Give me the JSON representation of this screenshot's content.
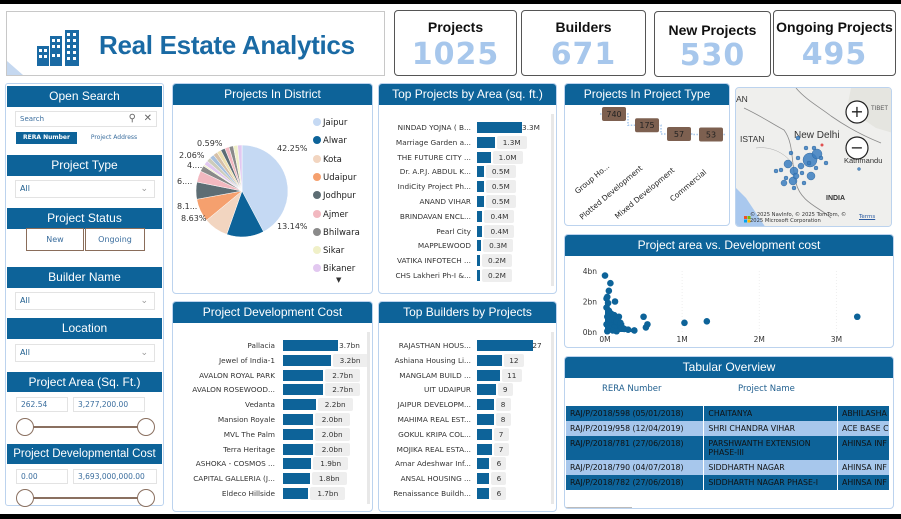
{
  "header": {
    "title": "Real Estate Analytics",
    "logo_icon": "buildings-icon"
  },
  "kpis": [
    {
      "label": "Projects",
      "value": "1025"
    },
    {
      "label": "Builders",
      "value": "671"
    },
    {
      "label": "New Projects",
      "value": "530"
    },
    {
      "label": "Ongoing Projects",
      "value": "495"
    }
  ],
  "filters": {
    "open_search": {
      "title": "Open Search",
      "placeholder": "Search",
      "search_icon": "search-icon",
      "clear_icon": "close-icon",
      "fields": [
        "RERA Number",
        "Project Address"
      ],
      "selected_field": "RERA Number"
    },
    "project_type": {
      "title": "Project Type",
      "value": "All"
    },
    "project_status": {
      "title": "Project Status",
      "options": [
        "New",
        "Ongoing"
      ]
    },
    "builder_name": {
      "title": "Builder Name",
      "value": "All"
    },
    "location": {
      "title": "Location",
      "value": "All"
    },
    "project_area": {
      "title": "Project Area (Sq. Ft.)",
      "min": "262.54",
      "max": "3,277,200.00"
    },
    "dev_cost": {
      "title": "Project Developmental Cost",
      "min": "0.00",
      "max": "3,693,000,000.00"
    }
  },
  "colors": {
    "accent": "#0d6399",
    "kpi_value": "#a7c7ec",
    "title": "#1a6aa4",
    "light_row": "#a7c7ec",
    "type_box": "#7d6050"
  },
  "chart_data": [
    {
      "id": "district",
      "type": "pie",
      "title": "Projects In District",
      "legend_position": "right",
      "categories": [
        "Jaipur",
        "Alwar",
        "Kota",
        "Udaipur",
        "Jodhpur",
        "Ajmer",
        "Bhilwara",
        "Sikar",
        "Bikaner"
      ],
      "legend_colors": [
        "#c5d9f3",
        "#0d6399",
        "#f2d5c0",
        "#f5a06e",
        "#5d6d74",
        "#f2b8c0",
        "#8a8a8a",
        "#f0f0c8",
        "#e2c8f0"
      ],
      "values": [
        42.25,
        13.14,
        8.63,
        8.1,
        6.0,
        4.0,
        2.06,
        0.59
      ],
      "data_labels": [
        "42.25%",
        "13.14%",
        "8.63%",
        "8.1...",
        "6....",
        "4....",
        "2.06%",
        "0.59%"
      ],
      "legend_more_icon": "caret-down-icon"
    },
    {
      "id": "area",
      "type": "bar",
      "orientation": "horizontal",
      "title": "Top Projects by Area (sq. ft.)",
      "categories": [
        "NINDAD YOJNA ( B...",
        "Marriage Garden a...",
        "THE FUTURE CITY ...",
        "Dr. A.P.J. ABDUL K...",
        "IndiCity Project Ph...",
        "ANAND VIHAR",
        "BRINDAVAN ENCL...",
        "Pearl City",
        "MAPPLEWOOD",
        "VATIKA INFOTECH ...",
        "CHS Lakheri Ph-I &..."
      ],
      "values": [
        3.3,
        1.3,
        1.0,
        0.5,
        0.5,
        0.5,
        0.4,
        0.4,
        0.3,
        0.2,
        0.2
      ],
      "labels": [
        "3.3M",
        "1.3M",
        "1.0M",
        "0.5M",
        "0.5M",
        "0.5M",
        "0.4M",
        "0.4M",
        "0.3M",
        "0.2M",
        "0.2M"
      ],
      "unit": "M sq. ft."
    },
    {
      "id": "type",
      "type": "bar",
      "title": "Projects In Project Type",
      "categories": [
        "Group Ho...",
        "Plotted Development",
        "Mixed Development",
        "Commercial"
      ],
      "values": [
        740,
        175,
        57,
        53
      ]
    },
    {
      "id": "scatter",
      "type": "scatter",
      "title": "Project area vs. Development cost",
      "xlabel": "",
      "ylabel": "",
      "x_ticks": [
        "0M",
        "1M",
        "2M",
        "3M"
      ],
      "y_ticks": [
        "0bn",
        "2bn",
        "4bn"
      ],
      "xlim": [
        0,
        3.5
      ],
      "ylim": [
        0,
        4
      ],
      "x_unit": "M sq. ft.",
      "y_unit": "bn",
      "points": [
        [
          0.0,
          3.7
        ],
        [
          0.07,
          3.2
        ],
        [
          0.05,
          2.7
        ],
        [
          0.03,
          2.3
        ],
        [
          0.13,
          2.0
        ],
        [
          0.02,
          2.2
        ],
        [
          0.04,
          1.9
        ],
        [
          0.02,
          1.6
        ],
        [
          0.05,
          1.4
        ],
        [
          0.08,
          1.2
        ],
        [
          0.12,
          1.1
        ],
        [
          0.18,
          1.0
        ],
        [
          0.03,
          1.0
        ],
        [
          0.1,
          0.8
        ],
        [
          0.15,
          0.7
        ],
        [
          0.2,
          0.6
        ],
        [
          0.05,
          0.6
        ],
        [
          0.08,
          0.4
        ],
        [
          0.12,
          0.3
        ],
        [
          0.22,
          0.3
        ],
        [
          0.25,
          0.2
        ],
        [
          0.3,
          0.15
        ],
        [
          0.38,
          0.1
        ],
        [
          0.02,
          0.5
        ],
        [
          0.06,
          0.2
        ],
        [
          0.1,
          0.1
        ],
        [
          0.15,
          0.05
        ],
        [
          0.03,
          0.05
        ],
        [
          0.5,
          1.0
        ],
        [
          0.55,
          0.5
        ],
        [
          0.53,
          0.3
        ],
        [
          1.03,
          0.6
        ],
        [
          1.32,
          0.7
        ],
        [
          3.27,
          1.0
        ]
      ]
    },
    {
      "id": "devcost",
      "type": "bar",
      "orientation": "horizontal",
      "title": "Project Development Cost",
      "categories": [
        "Pallacia",
        "Jewel of India-1",
        "AVALON ROYAL PARK",
        "AVALON ROSEWOOD...",
        "Vedanta",
        "Mansion Royale",
        "MVL The Palm",
        "Terra Heritage",
        "ASHOKA - COSMOS ...",
        "CAPITAL GALLERIA (J...",
        "Eldeco Hillside"
      ],
      "values": [
        3.7,
        3.2,
        2.7,
        2.7,
        2.2,
        2.0,
        2.0,
        2.0,
        1.9,
        1.8,
        1.7
      ],
      "labels": [
        "3.7bn",
        "3.2bn",
        "2.7bn",
        "2.7bn",
        "2.2bn",
        "2.0bn",
        "2.0bn",
        "2.0bn",
        "1.9bn",
        "1.8bn",
        "1.7bn"
      ],
      "unit": "bn"
    },
    {
      "id": "builders",
      "type": "bar",
      "orientation": "horizontal",
      "title": "Top Builders by Projects",
      "categories": [
        "RAJASTHAN HOUS...",
        "Ashiana Housing Li...",
        "MANGLAM BUILD ...",
        "UIT UDAIPUR",
        "JAIPUR DEVELOPM...",
        "MAHIMA REAL EST...",
        "GOKUL KRIPA COL...",
        "MOJIKA REAL ESTA...",
        "Amar Adeshwar Inf...",
        "ANSAL HOUSING ...",
        "Renaissance Buildh..."
      ],
      "values": [
        27,
        12,
        11,
        9,
        8,
        8,
        7,
        7,
        6,
        6,
        6
      ],
      "labels": [
        "27",
        "12",
        "11",
        "9",
        "8",
        "8",
        "7",
        "7",
        "6",
        "6",
        "6"
      ]
    }
  ],
  "map": {
    "labels": [
      "TIBET",
      "ISTAN",
      "New Delhi",
      "INDIA",
      "Kathmandu"
    ],
    "zoom_in_icon": "plus-icon",
    "zoom_out_icon": "minus-icon",
    "copyright": "© 2025 NavInfo, © 2025 TomTom, © 2025 Microsoft Corporation",
    "terms": "Terms",
    "brand": "Microsoft"
  },
  "table": {
    "title": "Tabular Overview",
    "columns": [
      "RERA Number",
      "Project Name",
      ""
    ],
    "rows": [
      [
        "RAJ/P/2018/598 (05/01/2018)",
        "CHAITANYA",
        "ABHILASHA"
      ],
      [
        "RAJ/P/2019/958 (12/04/2019)",
        "SHRI CHANDRA VIHAR",
        "ACE BASE C("
      ],
      [
        "RAJ/P/2018/781 (27/06/2018)",
        "PARSHWANTH EXTENSION PHASE-III",
        "AHINSA INF"
      ],
      [
        "RAJ/P/2018/790 (04/07/2018)",
        "SIDDHARTH NAGAR",
        "AHINSA INF"
      ],
      [
        "RAJ/P/2018/782 (27/06/2018)",
        "SIDDHARTH NAGAR PHASE-I",
        "AHINSA INF"
      ]
    ]
  }
}
